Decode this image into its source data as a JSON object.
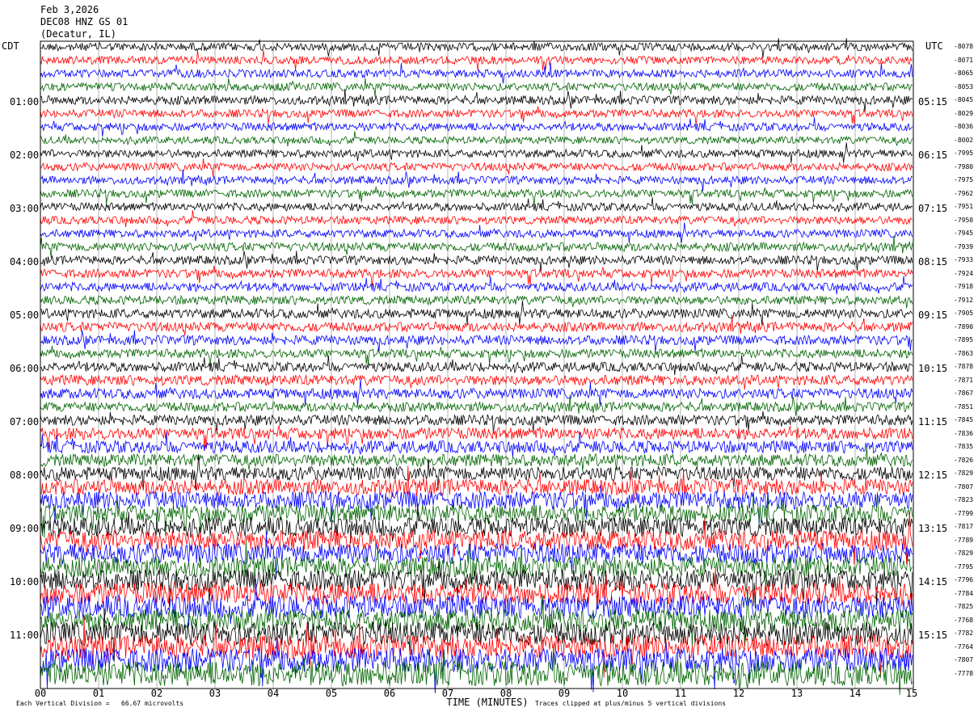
{
  "header": {
    "date": "Feb 3,2026",
    "station": "DEC08 HNZ GS 01",
    "location": "(Decatur, IL)",
    "left_tz": "CDT",
    "right_tz": "UTC"
  },
  "footer": {
    "scale": "Each Vertical Division =   66.67 microvolts",
    "clip_note": "Traces clipped at plus/minus 5 vertical divisions",
    "xlabel": "TIME (MINUTES)"
  },
  "colors": {
    "trace_cycle": [
      "#000000",
      "#ff0000",
      "#0000ff",
      "#006400"
    ],
    "grid": "#808080"
  },
  "chart_data": {
    "type": "line",
    "title": "DEC08 HNZ GS 01 (Decatur, IL)",
    "xlabel": "TIME (MINUTES)",
    "xlim": [
      0,
      15
    ],
    "x_tick_labels": [
      "00",
      "01",
      "02",
      "03",
      "04",
      "05",
      "06",
      "07",
      "08",
      "09",
      "10",
      "11",
      "12",
      "13",
      "14",
      "15"
    ],
    "trace_minutes": 15,
    "trace_count": 48,
    "left_hour_labels": [
      "01:00",
      "02:00",
      "03:00",
      "04:00",
      "05:00",
      "06:00",
      "07:00",
      "08:00",
      "09:00",
      "10:00",
      "11:00"
    ],
    "right_hour_labels": [
      "05:15",
      "06:15",
      "07:15",
      "08:15",
      "09:15",
      "10:15",
      "11:15",
      "12:15",
      "13:15",
      "14:15",
      "15:15"
    ],
    "trace_counts": [
      "-8078",
      "-8071",
      "-8065",
      "-8053",
      "-8045",
      "-8029",
      "-8036",
      "-8002",
      "-7995",
      "-7980",
      "-7975",
      "-7962",
      "-7951",
      "-7950",
      "-7945",
      "-7939",
      "-7933",
      "-7924",
      "-7918",
      "-7912",
      "-7905",
      "-7890",
      "-7895",
      "-7863",
      "-7878",
      "-7871",
      "-7867",
      "-7851",
      "-7845",
      "-7836",
      "-7835",
      "-7826",
      "-7829",
      "-7807",
      "-7823",
      "-7799",
      "-7817",
      "-7789",
      "-7829",
      "-7795",
      "-7796",
      "-7784",
      "-7825",
      "-7768",
      "-7782",
      "-7764",
      "-7807",
      "-7778"
    ],
    "relative_amplitude": [
      0.55,
      0.55,
      0.55,
      0.55,
      0.6,
      0.55,
      0.55,
      0.5,
      0.55,
      0.55,
      0.55,
      0.55,
      0.55,
      0.55,
      0.55,
      0.6,
      0.6,
      0.6,
      0.6,
      0.6,
      0.65,
      0.65,
      0.65,
      0.6,
      0.65,
      0.7,
      0.7,
      0.65,
      0.7,
      0.8,
      0.85,
      0.85,
      0.95,
      1.1,
      1.2,
      1.25,
      1.3,
      1.4,
      1.4,
      1.4,
      1.45,
      1.5,
      1.55,
      1.55,
      1.6,
      1.6,
      1.65,
      1.7
    ]
  }
}
